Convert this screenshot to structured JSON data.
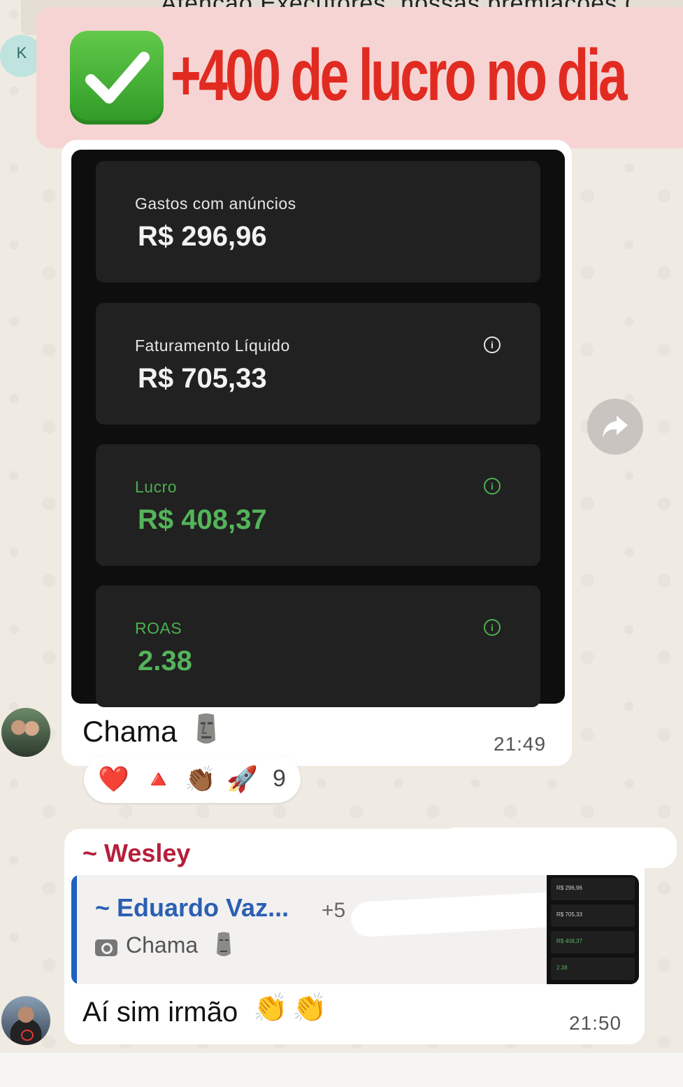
{
  "header": {
    "partial_title": "Atenção Executores, nossas premiações (",
    "top_avatar_initial": "K"
  },
  "banner": {
    "text": "+400 de lucro no dia",
    "check_icon": "check-mark-button-icon"
  },
  "message1": {
    "dashboard_cards": [
      {
        "label": "Gastos com anúncios",
        "value": "R$ 296,96",
        "info": false,
        "color": "#f2f2f2"
      },
      {
        "label": "Faturamento Líquido",
        "value": "R$ 705,33",
        "info": true,
        "color": "#f2f2f2"
      },
      {
        "label": "Lucro",
        "value": "R$ 408,37",
        "info": true,
        "color": "#54b45a"
      },
      {
        "label": "ROAS",
        "value": "2.38",
        "info": true,
        "color": "#54b45a"
      }
    ],
    "caption": "Chama",
    "time": "21:49"
  },
  "reactions": {
    "emojis": [
      "❤️",
      "🔺",
      "👏🏾",
      "🚀"
    ],
    "count": "9"
  },
  "message2": {
    "sender": "~ Wesley",
    "quote": {
      "author": "~ Eduardo Vaz...",
      "extra": "+5",
      "text": "Chama"
    },
    "thumb": {
      "rows": [
        "R$ 296,96",
        "R$ 705,33",
        "R$ 408,37",
        "2.38"
      ]
    },
    "text": "Aí sim irmão",
    "claps": [
      "👏",
      "👏"
    ],
    "time": "21:50"
  },
  "colors": {
    "banner_bg": "#f6d4d4",
    "banner_text": "#e12b21",
    "sender": "#b51f3b",
    "quote_author": "#2b5fb3",
    "accent_green": "#54b45a"
  }
}
